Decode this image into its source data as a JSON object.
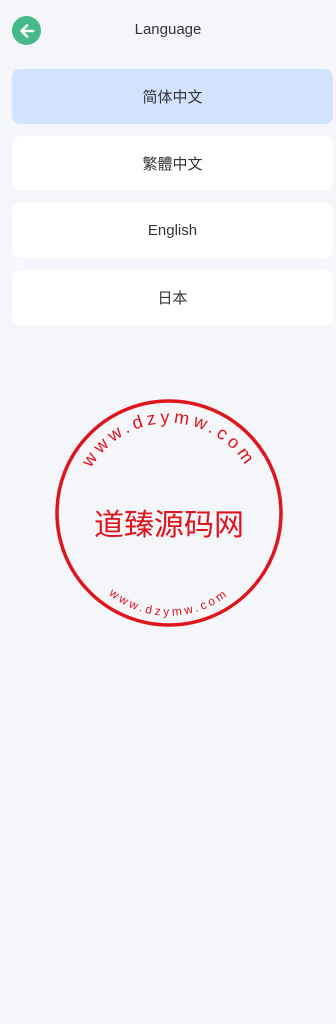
{
  "header": {
    "title": "Language",
    "back_icon": "arrow-left-icon"
  },
  "languages": [
    {
      "label": "简体中文",
      "selected": true
    },
    {
      "label": "繁體中文",
      "selected": false
    },
    {
      "label": "English",
      "selected": false
    },
    {
      "label": "日本",
      "selected": false
    }
  ],
  "watermark": {
    "center_text": "道臻源码网",
    "top_arc_text": "www.dzymw.com",
    "bottom_arc_text": "www.dzymw.com",
    "color": "#e0141c"
  },
  "colors": {
    "accent": "#46b98a",
    "selected_bg": "#d2e3ff",
    "page_bg": "#f4f6fa"
  }
}
